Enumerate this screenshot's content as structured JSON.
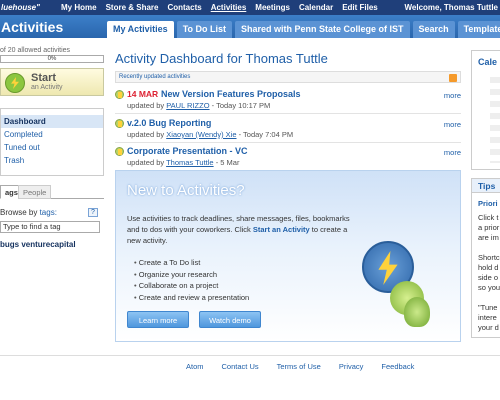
{
  "topbar": {
    "brand": "luehouse\"",
    "nav": [
      "My Home",
      "Store & Share",
      "Contacts",
      "Activities",
      "Meetings",
      "Calendar",
      "Edit Files"
    ],
    "active_nav": "Activities",
    "welcome": "Welcome, Thomas Tuttle"
  },
  "app": {
    "title": "Activities"
  },
  "tabs": [
    {
      "label": "My Activities",
      "active": true
    },
    {
      "label": "To Do List"
    },
    {
      "label": "Shared with Penn State College of IST"
    },
    {
      "label": "Search"
    },
    {
      "label": "Templates"
    }
  ],
  "sidebar": {
    "quota_text": "of 20 allowed activities",
    "quota_pct": "0%",
    "start_label": "Start",
    "start_sub": "an Activity",
    "menu": [
      "Dashboard",
      "Completed",
      "Tuned out",
      "Trash"
    ],
    "tag_tabs": [
      "ags",
      "People"
    ],
    "browse_prefix": "Browse by ",
    "browse_link": "tags:",
    "help": "?",
    "tag_input_placeholder": "Type to find a tag",
    "tag_link": "bugs venturecapital"
  },
  "main": {
    "title": "Activity Dashboard for Thomas Tuttle",
    "recent_label": "Recently updated activities",
    "items": [
      {
        "date": "14 MAR",
        "title": "New Version Features Proposals",
        "updated_by": "updated by ",
        "user": "PAUL RIZZO",
        "when": " - Today 10:17 PM",
        "more": "more"
      },
      {
        "date": "",
        "title": "v.2.0 Bug Reporting",
        "updated_by": "updated by ",
        "user": "Xiaoyan (Wendy) Xie",
        "when": " - Today 7:04 PM",
        "more": "more"
      },
      {
        "date": "",
        "title": "Corporate Presentation - VC",
        "updated_by": "updated by ",
        "user": "Thomas Tuttle",
        "when": " - 5 Mar",
        "more": "more"
      }
    ]
  },
  "promo": {
    "heading": "New to Activities?",
    "text1": "Use activities to track deadlines, share messages, files, bookmarks and to dos with your coworkers. Click ",
    "text_link": "Start an Activity",
    "text2": " to create a new activity.",
    "bullets": [
      "Create a To Do list",
      "Organize your research",
      "Collaborate on a project",
      "Create and review a presentation"
    ],
    "btn_learn": "Learn more",
    "btn_demo": "Watch demo"
  },
  "right": {
    "box1_head": "Cale",
    "tips_head": "Tips",
    "tips_lines": [
      "Priori",
      "Click t",
      "a prior",
      "are im",
      "",
      "Shortc",
      "hold d",
      "side o",
      "so you",
      "",
      "\"Tune",
      "intere",
      "your d"
    ]
  },
  "footer": [
    "Atom",
    "Contact Us",
    "Terms of Use",
    "Privacy",
    "Feedback"
  ]
}
